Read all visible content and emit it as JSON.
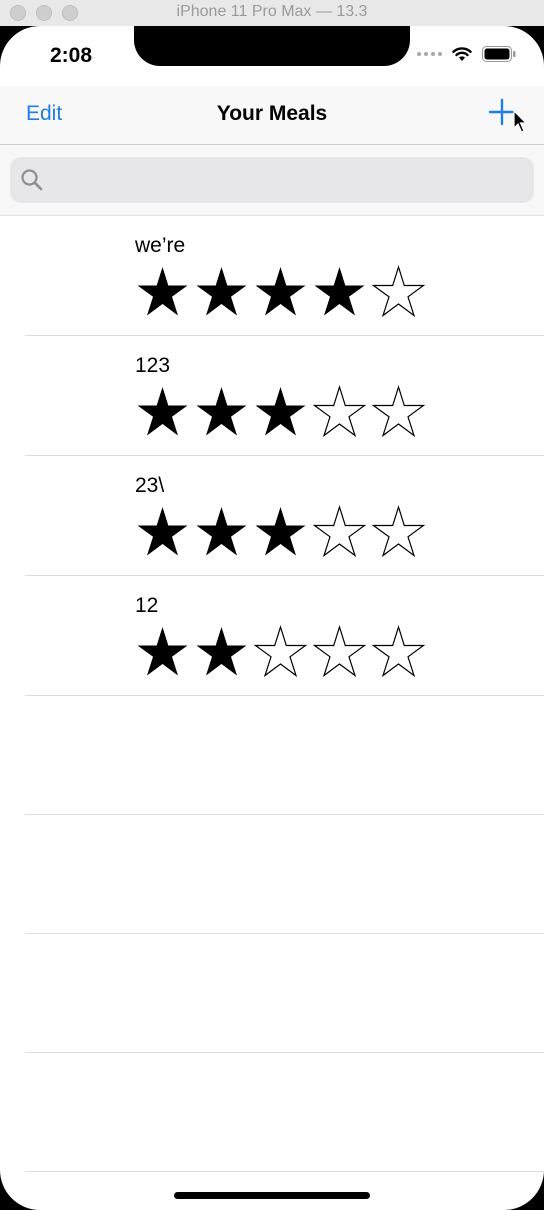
{
  "window": {
    "title": "iPhone 11 Pro Max — 13.3"
  },
  "status_bar": {
    "time": "2:08"
  },
  "nav": {
    "edit_label": "Edit",
    "title": "Your Meals",
    "add_icon": "plus-icon"
  },
  "search": {
    "placeholder": "",
    "value": ""
  },
  "meals": [
    {
      "name": "we’re",
      "rating": 4
    },
    {
      "name": "123",
      "rating": 3
    },
    {
      "name": "23\\",
      "rating": 3
    },
    {
      "name": "12",
      "rating": 2
    }
  ],
  "rating_max": 5,
  "colors": {
    "accent": "#1e7ee4",
    "star": "#000000"
  }
}
